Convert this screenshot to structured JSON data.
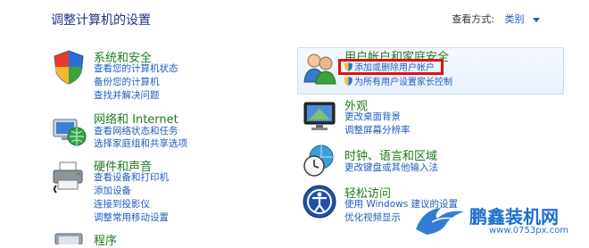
{
  "header": {
    "title": "调整计算机的设置",
    "view_by_label": "查看方式:",
    "view_by_value": "类别"
  },
  "left": [
    {
      "title": "系统和安全",
      "icon": "shield-icon",
      "links": [
        "查看您的计算机状态",
        "备份您的计算机",
        "查找并解决问题"
      ]
    },
    {
      "title": "网络和 Internet",
      "icon": "network-globe-icon",
      "links": [
        "查看网络状态和任务",
        "选择家庭组和共享选项"
      ]
    },
    {
      "title": "硬件和声音",
      "icon": "printer-icon",
      "links": [
        "查看设备和打印机",
        "添加设备",
        "连接到投影仪",
        "调整常用移动设置"
      ]
    },
    {
      "title": "程序",
      "icon": "programs-icon",
      "links": []
    }
  ],
  "right": [
    {
      "title": "用户帐户和家庭安全",
      "icon": "users-icon",
      "links": [
        "添加或删除用户帐户",
        "为所有用户设置家长控制"
      ]
    },
    {
      "title": "外观",
      "icon": "appearance-monitor-icon",
      "links": [
        "更改桌面背景",
        "调整屏幕分辨率"
      ]
    },
    {
      "title": "时钟、语言和区域",
      "icon": "clock-globe-icon",
      "links": [
        "更改键盘或其他输入法"
      ]
    },
    {
      "title": "轻松访问",
      "icon": "ease-of-access-icon",
      "links": [
        "使用 Windows 建议的设置",
        "优化视频显示"
      ]
    }
  ],
  "watermark": {
    "brand": "鹏鑫装机网",
    "url": "www.0753px.com"
  },
  "colors": {
    "category_title": "#1e7a1e",
    "link": "#1e5bbf",
    "highlight_box": "#e01010"
  }
}
